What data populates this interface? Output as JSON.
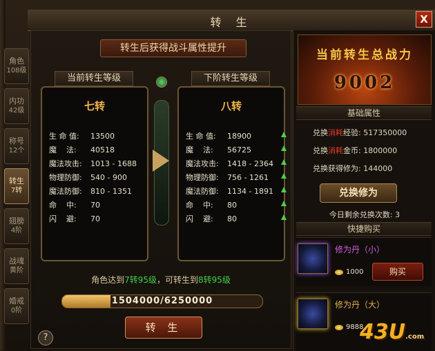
{
  "window": {
    "title": "转 生",
    "close_label": "X"
  },
  "tabs": [
    {
      "label": "角色",
      "sub": "108级"
    },
    {
      "label": "内功",
      "sub": "42级"
    },
    {
      "label": "称号",
      "sub": "12个"
    },
    {
      "label": "转生",
      "sub": "7转"
    },
    {
      "label": "翅膀",
      "sub": "4阶"
    },
    {
      "label": "战魂",
      "sub": "黄阶"
    },
    {
      "label": "婚戒",
      "sub": "0阶"
    }
  ],
  "banner": "转生后获得战斗属性提升",
  "current": {
    "header": "当前转生等级",
    "rank": "七转",
    "stats": [
      {
        "label": "生 命 值:",
        "value": "13500"
      },
      {
        "label": "魔    法:",
        "value": "40518"
      },
      {
        "label": "魔法攻击:",
        "value": "1013 - 1688"
      },
      {
        "label": "物理防御:",
        "value": "540 - 900"
      },
      {
        "label": "魔法防御:",
        "value": "810 - 1351"
      },
      {
        "label": "命    中:",
        "value": "70"
      },
      {
        "label": "闪    避:",
        "value": "70"
      }
    ]
  },
  "next": {
    "header": "下阶转生等级",
    "rank": "八转",
    "stats": [
      {
        "label": "生 命 值:",
        "value": "18900"
      },
      {
        "label": "魔    法:",
        "value": "56725"
      },
      {
        "label": "魔法攻击:",
        "value": "1418 - 2364"
      },
      {
        "label": "物理防御:",
        "value": "756 - 1261"
      },
      {
        "label": "魔法防御:",
        "value": "1134 - 1891"
      },
      {
        "label": "命    中:",
        "value": "80"
      },
      {
        "label": "闪    避:",
        "value": "80"
      }
    ]
  },
  "requirement": {
    "prefix": "角色达到",
    "level_a": "7转95级",
    "middle": "，可转生到",
    "level_b": "8转95级"
  },
  "progress": {
    "text": "1504000/6250000",
    "current": 1504000,
    "max": 6250000
  },
  "rebirth_button": "转 生",
  "help_label": "?",
  "power": {
    "title": "当前转生总战力",
    "value": "9002"
  },
  "basic_attr_header": "基础属性",
  "exchange": {
    "exp": {
      "prefix": "兑换",
      "red": "消耗",
      "suffix": "经验: 517350000"
    },
    "gold": {
      "prefix": "兑换",
      "red": "消耗",
      "suffix": "金币: 1800000"
    },
    "gain": "兑换获得修为: 144000",
    "button": "兑换修为",
    "remaining": "今日剩余兑换次数: 3"
  },
  "quick_buy_header": "快捷购买",
  "shop": [
    {
      "name": "修为丹（小）",
      "price": "1000",
      "buy": "购买",
      "icon": "small-pill-icon"
    },
    {
      "name": "修为丹（大）",
      "price": "9888",
      "icon": "large-pill-icon"
    }
  ],
  "logo": {
    "main": "43U",
    "suffix": ".com"
  }
}
